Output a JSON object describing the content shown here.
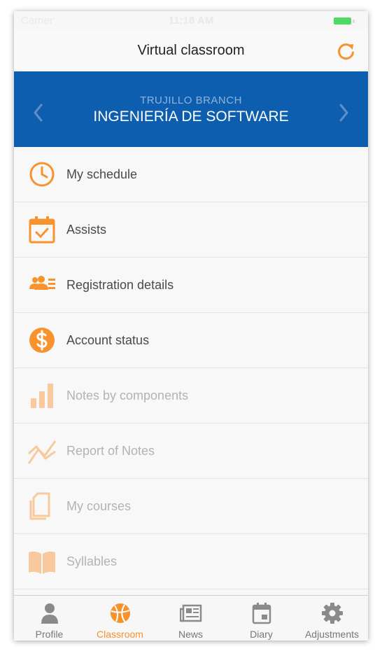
{
  "status_bar": {
    "carrier": "Carrier",
    "time": "11:18 AM"
  },
  "header": {
    "title": "Virtual classroom",
    "refresh_icon": "refresh-icon"
  },
  "branch": {
    "subtitle": "TRUJILLO BRANCH",
    "title": "INGENIERÍA DE SOFTWARE"
  },
  "menu": {
    "items": [
      {
        "label": "My schedule",
        "icon": "clock-icon",
        "enabled": true
      },
      {
        "label": "Assists",
        "icon": "calendar-check-icon",
        "enabled": true
      },
      {
        "label": "Registration details",
        "icon": "users-list-icon",
        "enabled": true
      },
      {
        "label": "Account status",
        "icon": "dollar-icon",
        "enabled": true
      },
      {
        "label": "Notes by components",
        "icon": "bar-chart-icon",
        "enabled": false
      },
      {
        "label": "Report of Notes",
        "icon": "line-chart-icon",
        "enabled": false
      },
      {
        "label": "My courses",
        "icon": "documents-icon",
        "enabled": false
      },
      {
        "label": "Syllables",
        "icon": "book-icon",
        "enabled": false
      }
    ]
  },
  "tabs": [
    {
      "label": "Profile",
      "icon": "person-icon",
      "active": false
    },
    {
      "label": "Classroom",
      "icon": "basketball-icon",
      "active": true
    },
    {
      "label": "News",
      "icon": "newspaper-icon",
      "active": false
    },
    {
      "label": "Diary",
      "icon": "calendar-icon",
      "active": false
    },
    {
      "label": "Adjustments",
      "icon": "gear-icon",
      "active": false
    }
  ],
  "colors": {
    "accent": "#f7922d",
    "banner": "#0d5eaf",
    "inactive_tab": "#777777"
  }
}
